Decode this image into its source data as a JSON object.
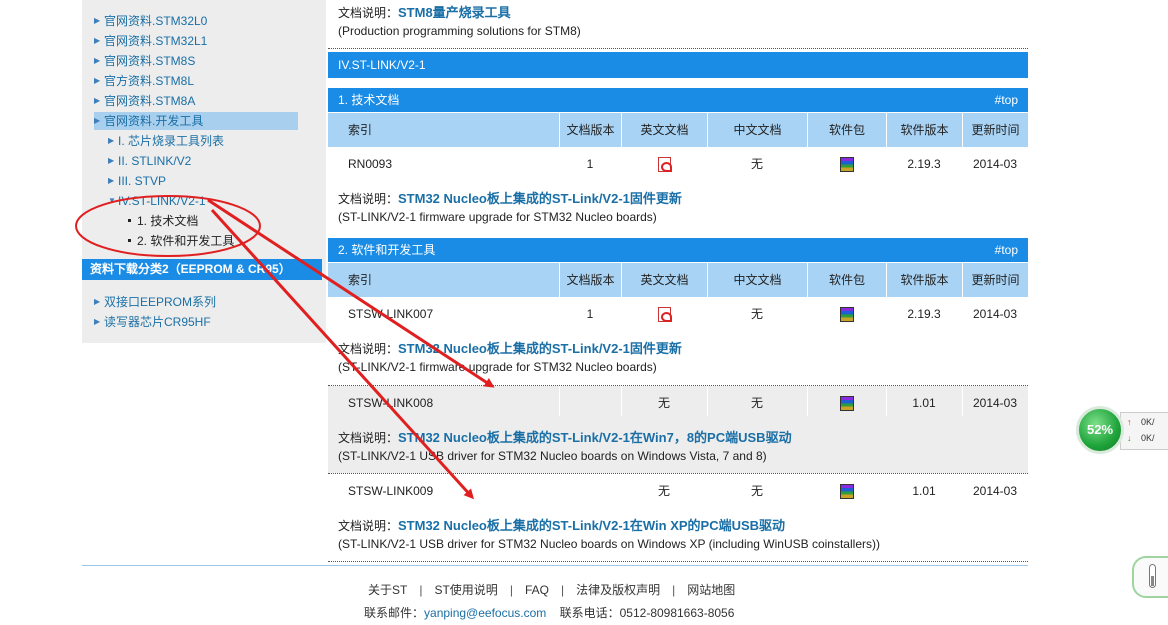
{
  "sidebar": {
    "items": [
      {
        "label": "官网资料.STM32L0"
      },
      {
        "label": "官网资料.STM32L1"
      },
      {
        "label": "官网资料.STM8S"
      },
      {
        "label": "官方资料.STM8L"
      },
      {
        "label": "官网资料.STM8A"
      },
      {
        "label": "官网资料.开发工具"
      }
    ],
    "tools": [
      {
        "label": "I. 芯片烧录工具列表"
      },
      {
        "label": "II. STLINK/V2"
      },
      {
        "label": "III. STVP"
      },
      {
        "label": "IV.ST-LINK/V2-1"
      }
    ],
    "subs": [
      {
        "label": "1. 技术文档"
      },
      {
        "label": "2. 软件和开发工具"
      }
    ],
    "category2": "资料下载分类2（EEPROM & CR95）",
    "cat2_items": [
      {
        "label": "双接口EEPROM系列"
      },
      {
        "label": "读写器芯片CR95HF"
      }
    ]
  },
  "main": {
    "top_desc_label": "文档说明：",
    "top_desc_link": "STM8量产烧录工具",
    "top_desc_en": "(Production programming solutions for STM8)",
    "section_title": "IV.ST-LINK/V2-1",
    "top_link": "#top",
    "headers": [
      "索引",
      "文档版本",
      "英文文档",
      "中文文档",
      "软件包",
      "软件版本",
      "更新时间"
    ],
    "desc_label": "文档说明：",
    "sub1": {
      "title": "1. 技术文档",
      "rows": [
        {
          "index": "RN0093",
          "doc_ver": "1",
          "cn_doc": "无",
          "sw_ver": "2.19.3",
          "date": "2014-03",
          "desc_link": "STM32 Nucleo板上集成的ST-Link/V2-1固件更新",
          "desc_en": "(ST-LINK/V2-1 firmware upgrade for STM32 Nucleo boards)"
        }
      ]
    },
    "sub2": {
      "title": "2. 软件和开发工具",
      "rows": [
        {
          "index": "STSW-LINK007",
          "doc_ver": "1",
          "cn_doc": "无",
          "sw_ver": "2.19.3",
          "date": "2014-03",
          "desc_link": "STM32 Nucleo板上集成的ST-Link/V2-1固件更新",
          "desc_en": "(ST-LINK/V2-1 firmware upgrade for STM32 Nucleo boards)"
        },
        {
          "index": "STSW-LINK008",
          "doc_ver": "",
          "en_doc": "无",
          "cn_doc": "无",
          "sw_ver": "1.01",
          "date": "2014-03",
          "desc_link": "STM32 Nucleo板上集成的ST-Link/V2-1在Win7，8的PC端USB驱动",
          "desc_en": "(ST-LINK/V2-1 USB driver for STM32 Nucleo boards on Windows Vista, 7 and 8)"
        },
        {
          "index": "STSW-LINK009",
          "doc_ver": "",
          "en_doc": "无",
          "cn_doc": "无",
          "sw_ver": "1.01",
          "date": "2014-03",
          "desc_link": "STM32 Nucleo板上集成的ST-Link/V2-1在Win XP的PC端USB驱动",
          "desc_en": "(ST-LINK/V2-1 USB driver for STM32 Nucleo boards on Windows XP (including WinUSB coinstallers))"
        }
      ]
    }
  },
  "footer": {
    "links": [
      "关于ST",
      "ST使用说明",
      "FAQ",
      "法律及版权声明",
      "网站地图"
    ],
    "separator": "|",
    "email_label": "联系邮件：",
    "email": "yanping@eefocus.com",
    "phone_label": "联系电话：",
    "phone": "0512-80981663-8056"
  },
  "widget": {
    "percent": "52%",
    "up_rate": "0K/",
    "down_rate": "0K/",
    "up_arrow": "↑",
    "down_arrow": "↓"
  },
  "colors": {
    "accent_blue": "#1a8ce6",
    "header_light_blue": "#a8d3f5",
    "link_blue": "#1a6fa6",
    "annotation_red": "#e02020"
  }
}
